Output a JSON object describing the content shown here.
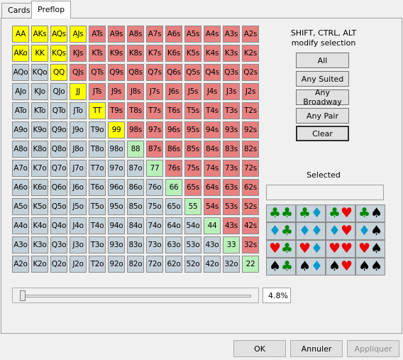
{
  "tabs": [
    {
      "label": "Cards",
      "active": false
    },
    {
      "label": "Preflop",
      "active": true
    }
  ],
  "colors": {
    "selected": "#ffff00",
    "suited": "#e88080",
    "offsuit": "#c5d1d8",
    "pair": "#b9f0b9"
  },
  "grid": {
    "rows": [
      [
        [
          "AA",
          "selected"
        ],
        [
          "AKs",
          "selected"
        ],
        [
          "AQs",
          "selected"
        ],
        [
          "AJs",
          "selected"
        ],
        [
          "ATs",
          "suited"
        ],
        [
          "A9s",
          "suited"
        ],
        [
          "A8s",
          "suited"
        ],
        [
          "A7s",
          "suited"
        ],
        [
          "A6s",
          "suited"
        ],
        [
          "A5s",
          "suited"
        ],
        [
          "A4s",
          "suited"
        ],
        [
          "A3s",
          "suited"
        ],
        [
          "A2s",
          "suited"
        ]
      ],
      [
        [
          "AKo",
          "selected"
        ],
        [
          "KK",
          "selected"
        ],
        [
          "KQs",
          "selected"
        ],
        [
          "KJs",
          "suited"
        ],
        [
          "KTs",
          "suited"
        ],
        [
          "K9s",
          "suited"
        ],
        [
          "K8s",
          "suited"
        ],
        [
          "K7s",
          "suited"
        ],
        [
          "K6s",
          "suited"
        ],
        [
          "K5s",
          "suited"
        ],
        [
          "K4s",
          "suited"
        ],
        [
          "K3s",
          "suited"
        ],
        [
          "K2s",
          "suited"
        ]
      ],
      [
        [
          "AQo",
          "offsuit"
        ],
        [
          "KQo",
          "offsuit"
        ],
        [
          "QQ",
          "selected"
        ],
        [
          "QJs",
          "suited"
        ],
        [
          "QTs",
          "suited"
        ],
        [
          "Q9s",
          "suited"
        ],
        [
          "Q8s",
          "suited"
        ],
        [
          "Q7s",
          "suited"
        ],
        [
          "Q6s",
          "suited"
        ],
        [
          "Q5s",
          "suited"
        ],
        [
          "Q4s",
          "suited"
        ],
        [
          "Q3s",
          "suited"
        ],
        [
          "Q2s",
          "suited"
        ]
      ],
      [
        [
          "AJo",
          "offsuit"
        ],
        [
          "KJo",
          "offsuit"
        ],
        [
          "QJo",
          "offsuit"
        ],
        [
          "JJ",
          "selected"
        ],
        [
          "JTs",
          "suited"
        ],
        [
          "J9s",
          "suited"
        ],
        [
          "J8s",
          "suited"
        ],
        [
          "J7s",
          "suited"
        ],
        [
          "J6s",
          "suited"
        ],
        [
          "J5s",
          "suited"
        ],
        [
          "J4s",
          "suited"
        ],
        [
          "J3s",
          "suited"
        ],
        [
          "J2s",
          "suited"
        ]
      ],
      [
        [
          "ATo",
          "offsuit"
        ],
        [
          "KTo",
          "offsuit"
        ],
        [
          "QTo",
          "offsuit"
        ],
        [
          "JTo",
          "offsuit"
        ],
        [
          "TT",
          "selected"
        ],
        [
          "T9s",
          "suited"
        ],
        [
          "T8s",
          "suited"
        ],
        [
          "T7s",
          "suited"
        ],
        [
          "T6s",
          "suited"
        ],
        [
          "T5s",
          "suited"
        ],
        [
          "T4s",
          "suited"
        ],
        [
          "T3s",
          "suited"
        ],
        [
          "T2s",
          "suited"
        ]
      ],
      [
        [
          "A9o",
          "offsuit"
        ],
        [
          "K9o",
          "offsuit"
        ],
        [
          "Q9o",
          "offsuit"
        ],
        [
          "J9o",
          "offsuit"
        ],
        [
          "T9o",
          "offsuit"
        ],
        [
          "99",
          "selected"
        ],
        [
          "98s",
          "suited"
        ],
        [
          "97s",
          "suited"
        ],
        [
          "96s",
          "suited"
        ],
        [
          "95s",
          "suited"
        ],
        [
          "94s",
          "suited"
        ],
        [
          "93s",
          "suited"
        ],
        [
          "92s",
          "suited"
        ]
      ],
      [
        [
          "A8o",
          "offsuit"
        ],
        [
          "K8o",
          "offsuit"
        ],
        [
          "Q8o",
          "offsuit"
        ],
        [
          "J8o",
          "offsuit"
        ],
        [
          "T8o",
          "offsuit"
        ],
        [
          "98o",
          "offsuit"
        ],
        [
          "88",
          "pair"
        ],
        [
          "87s",
          "suited"
        ],
        [
          "86s",
          "suited"
        ],
        [
          "85s",
          "suited"
        ],
        [
          "84s",
          "suited"
        ],
        [
          "83s",
          "suited"
        ],
        [
          "82s",
          "suited"
        ]
      ],
      [
        [
          "A7o",
          "offsuit"
        ],
        [
          "K7o",
          "offsuit"
        ],
        [
          "Q7o",
          "offsuit"
        ],
        [
          "J7o",
          "offsuit"
        ],
        [
          "T7o",
          "offsuit"
        ],
        [
          "97o",
          "offsuit"
        ],
        [
          "87o",
          "offsuit"
        ],
        [
          "77",
          "pair"
        ],
        [
          "76s",
          "suited"
        ],
        [
          "75s",
          "suited"
        ],
        [
          "74s",
          "suited"
        ],
        [
          "73s",
          "suited"
        ],
        [
          "72s",
          "suited"
        ]
      ],
      [
        [
          "A6o",
          "offsuit"
        ],
        [
          "K6o",
          "offsuit"
        ],
        [
          "Q6o",
          "offsuit"
        ],
        [
          "J6o",
          "offsuit"
        ],
        [
          "T6o",
          "offsuit"
        ],
        [
          "96o",
          "offsuit"
        ],
        [
          "86o",
          "offsuit"
        ],
        [
          "76o",
          "offsuit"
        ],
        [
          "66",
          "pair"
        ],
        [
          "65s",
          "suited"
        ],
        [
          "64s",
          "suited"
        ],
        [
          "63s",
          "suited"
        ],
        [
          "62s",
          "suited"
        ]
      ],
      [
        [
          "A5o",
          "offsuit"
        ],
        [
          "K5o",
          "offsuit"
        ],
        [
          "Q5o",
          "offsuit"
        ],
        [
          "J5o",
          "offsuit"
        ],
        [
          "T5o",
          "offsuit"
        ],
        [
          "95o",
          "offsuit"
        ],
        [
          "85o",
          "offsuit"
        ],
        [
          "75o",
          "offsuit"
        ],
        [
          "65o",
          "offsuit"
        ],
        [
          "55",
          "pair"
        ],
        [
          "54s",
          "suited"
        ],
        [
          "53s",
          "suited"
        ],
        [
          "52s",
          "suited"
        ]
      ],
      [
        [
          "A4o",
          "offsuit"
        ],
        [
          "K4o",
          "offsuit"
        ],
        [
          "Q4o",
          "offsuit"
        ],
        [
          "J4o",
          "offsuit"
        ],
        [
          "T4o",
          "offsuit"
        ],
        [
          "94o",
          "offsuit"
        ],
        [
          "84o",
          "offsuit"
        ],
        [
          "74o",
          "offsuit"
        ],
        [
          "64o",
          "offsuit"
        ],
        [
          "54o",
          "offsuit"
        ],
        [
          "44",
          "pair"
        ],
        [
          "43s",
          "suited"
        ],
        [
          "42s",
          "suited"
        ]
      ],
      [
        [
          "A3o",
          "offsuit"
        ],
        [
          "K3o",
          "offsuit"
        ],
        [
          "Q3o",
          "offsuit"
        ],
        [
          "J3o",
          "offsuit"
        ],
        [
          "T3o",
          "offsuit"
        ],
        [
          "93o",
          "offsuit"
        ],
        [
          "83o",
          "offsuit"
        ],
        [
          "73o",
          "offsuit"
        ],
        [
          "63o",
          "offsuit"
        ],
        [
          "53o",
          "offsuit"
        ],
        [
          "43o",
          "offsuit"
        ],
        [
          "33",
          "pair"
        ],
        [
          "32s",
          "suited"
        ]
      ],
      [
        [
          "A2o",
          "offsuit"
        ],
        [
          "K2o",
          "offsuit"
        ],
        [
          "Q2o",
          "offsuit"
        ],
        [
          "J2o",
          "offsuit"
        ],
        [
          "T2o",
          "offsuit"
        ],
        [
          "92o",
          "offsuit"
        ],
        [
          "82o",
          "offsuit"
        ],
        [
          "72o",
          "offsuit"
        ],
        [
          "62o",
          "offsuit"
        ],
        [
          "52o",
          "offsuit"
        ],
        [
          "42o",
          "offsuit"
        ],
        [
          "32o",
          "offsuit"
        ],
        [
          "22",
          "pair"
        ]
      ]
    ]
  },
  "modifier": {
    "line1": "SHIFT, CTRL, ALT",
    "line2": "modify selection"
  },
  "buttons": {
    "all": "All",
    "any_suited": "Any Suited",
    "any_broadway": "Any Broadway",
    "any_pair": "Any Pair",
    "clear": "Clear"
  },
  "selected_label": "Selected",
  "selected_value": "",
  "suit_icons": {
    "spade": {
      "glyph": "♠",
      "color": "#000000"
    },
    "club": {
      "glyph": "♣",
      "color": "#008800"
    },
    "diamond": {
      "glyph": "♦",
      "color": "#0099cc"
    },
    "heart": {
      "glyph": "♥",
      "color": "#ee0000"
    }
  },
  "suit_combos": [
    [
      [
        "club",
        "club"
      ],
      [
        "club",
        "diamond"
      ],
      [
        "club",
        "heart"
      ],
      [
        "club",
        "spade"
      ]
    ],
    [
      [
        "diamond",
        "club"
      ],
      [
        "diamond",
        "diamond"
      ],
      [
        "diamond",
        "heart"
      ],
      [
        "diamond",
        "spade"
      ]
    ],
    [
      [
        "heart",
        "club"
      ],
      [
        "heart",
        "diamond"
      ],
      [
        "heart",
        "heart"
      ],
      [
        "heart",
        "spade"
      ]
    ],
    [
      [
        "spade",
        "club"
      ],
      [
        "spade",
        "diamond"
      ],
      [
        "spade",
        "heart"
      ],
      [
        "spade",
        "spade"
      ]
    ]
  ],
  "slider": {
    "percent_value": 4.8,
    "percent_text": "4.8%"
  },
  "footer": {
    "ok": "OK",
    "cancel": "Annuler",
    "apply": "Appliquer"
  }
}
